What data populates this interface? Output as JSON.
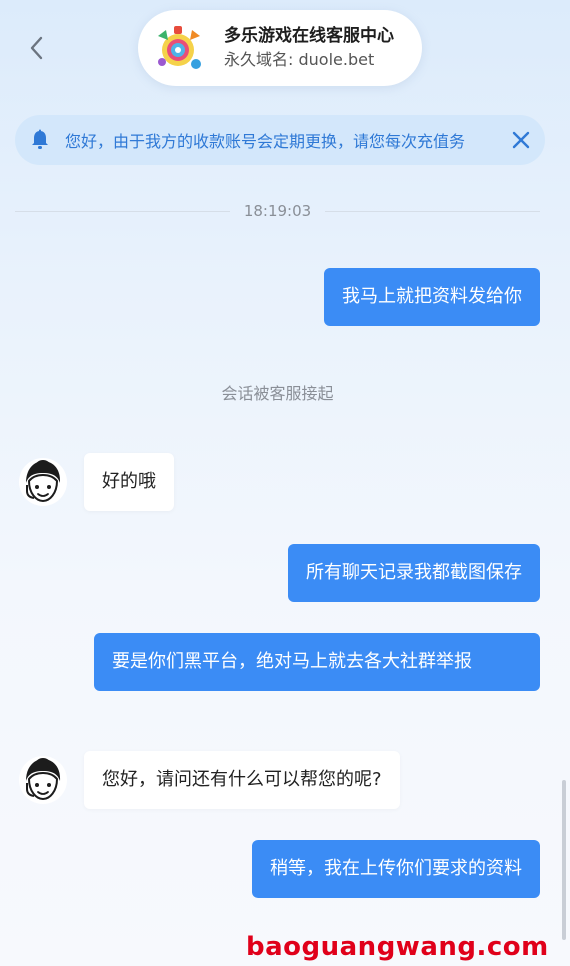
{
  "header": {
    "title": "多乐游戏在线客服中心",
    "subtitle": "永久域名: duole.bet"
  },
  "notice": {
    "text": "您好，由于我方的收款账号会定期更换，请您每次充值务"
  },
  "chat": {
    "timestamp": "18:19:03",
    "system_message": "会话被客服接起",
    "messages": [
      {
        "from": "user",
        "text": "我马上就把资料发给你"
      },
      {
        "from": "agent",
        "text": "好的哦"
      },
      {
        "from": "user",
        "text": "所有聊天记录我都截图保存"
      },
      {
        "from": "user",
        "text": "要是你们黑平台，绝对马上就去各大社群举报"
      },
      {
        "from": "agent",
        "text": "您好，请问还有什么可以帮您的呢?"
      },
      {
        "from": "user",
        "text": "稍等，我在上传你们要求的资料"
      }
    ]
  },
  "watermark": "baoguangwang.com",
  "colors": {
    "user_bubble": "#3b8cf5",
    "notice_bg": "#d3e7fb",
    "notice_text": "#2f79d6",
    "watermark": "#e0001a"
  },
  "icons": {
    "back": "chevron-left-icon",
    "notice": "bell-icon",
    "close": "close-icon",
    "avatar": "agent-avatar"
  }
}
